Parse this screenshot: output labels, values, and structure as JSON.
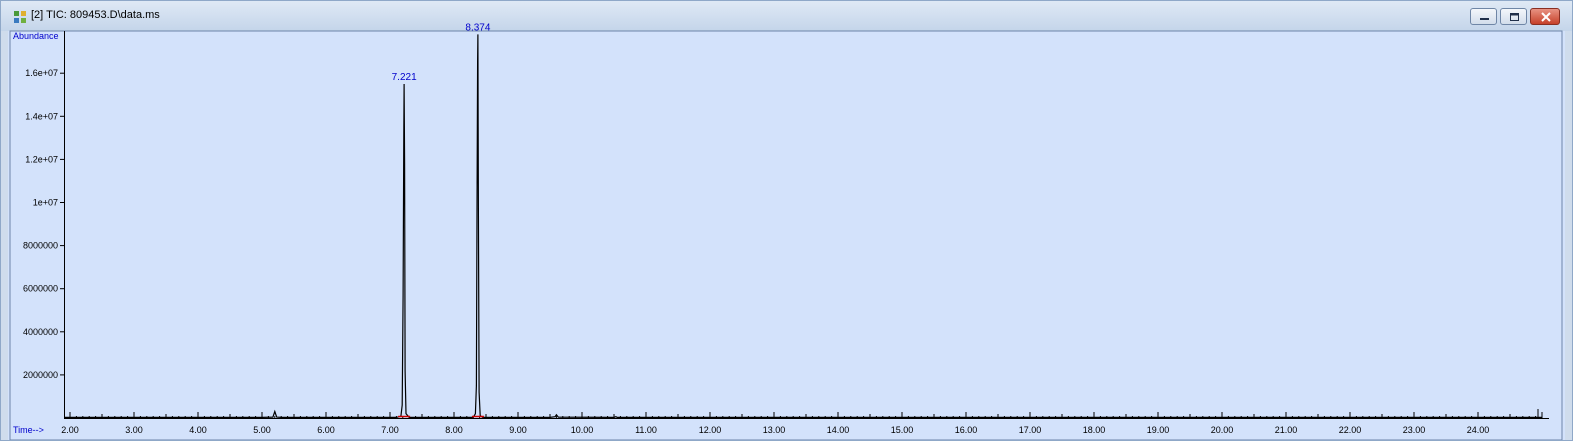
{
  "window": {
    "title": "[2] TIC: 809453.D\\data.ms",
    "icon": "chromatogram-app-icon",
    "controls": [
      "minimize-icon",
      "maximize-icon",
      "close-icon"
    ]
  },
  "chart_data": {
    "type": "line",
    "ylabel": "Abundance",
    "xlabel": "Time-->",
    "xlim": [
      1.0,
      25.0
    ],
    "ylim": [
      0,
      18000000
    ],
    "x_ticks": [
      "2.00",
      "3.00",
      "4.00",
      "5.00",
      "6.00",
      "7.00",
      "8.00",
      "9.00",
      "10.00",
      "11.00",
      "12.00",
      "13.00",
      "14.00",
      "15.00",
      "16.00",
      "17.00",
      "18.00",
      "19.00",
      "20.00",
      "21.00",
      "22.00",
      "23.00",
      "24.00"
    ],
    "y_ticks": [
      "2000000",
      "4000000",
      "6000000",
      "8000000",
      "1e+07",
      "1.2e+07",
      "1.4e+07",
      "1.6e+07"
    ],
    "y_tick_values": [
      2000000,
      4000000,
      6000000,
      8000000,
      10000000,
      12000000,
      14000000,
      16000000
    ],
    "grid": false,
    "colors": {
      "background": "#d3e2fb",
      "trace": "#000000",
      "annotation": "#0000cc",
      "integration": "#cc0000",
      "frame": "#000000"
    },
    "peak_labels": [
      {
        "label": "7.221",
        "rt": 7.221,
        "abundance": 15500000
      },
      {
        "label": "8.374",
        "rt": 8.374,
        "abundance": 17800000
      }
    ],
    "series": [
      {
        "x": [
          1.0,
          5.0,
          5.17,
          5.2,
          5.23,
          5.3,
          7.1,
          7.17,
          7.19,
          7.205,
          7.215,
          7.221,
          7.228,
          7.236,
          7.25,
          7.3,
          8.3,
          8.335,
          8.35,
          8.36,
          8.368,
          8.374,
          8.382,
          8.392,
          8.41,
          8.45,
          9.5,
          9.58,
          9.6,
          9.63,
          10.5,
          10.53,
          10.55,
          25.0
        ],
        "y": [
          30000,
          30000,
          40000,
          300000,
          40000,
          30000,
          30000,
          80000,
          600000,
          5700000,
          13200000,
          15500000,
          11800000,
          2200000,
          200000,
          30000,
          30000,
          200000,
          1500000,
          9700000,
          16500000,
          17800000,
          9600000,
          1200000,
          100000,
          30000,
          30000,
          60000,
          150000,
          40000,
          30000,
          60000,
          30000,
          30000
        ]
      }
    ]
  }
}
